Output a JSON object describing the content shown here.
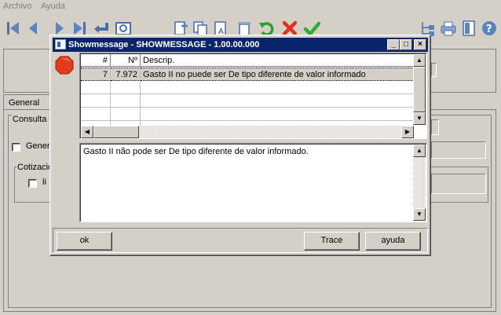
{
  "menu": {
    "items": [
      "Archivo",
      "Ayuda"
    ]
  },
  "background": {
    "tab_general": "General",
    "group_consulta": "Consulta t",
    "check_general": "Gener",
    "group_cotizacion": "Cotizacio",
    "check_li": "li"
  },
  "dialog": {
    "title": "Showmessage - SHOWMESSAGE - 1.00.00.000",
    "columns": [
      "#",
      "Nº",
      "Descrip."
    ],
    "rows": [
      {
        "num": "7",
        "code": "7.972",
        "descrip": "Gasto II no puede ser De tipo diferente de valor informado"
      }
    ],
    "detail_text": "Gasto II não pode ser De tipo diferente de valor informado.",
    "buttons": {
      "ok": "ok",
      "trace": "Trace",
      "help": "ayuda"
    }
  }
}
